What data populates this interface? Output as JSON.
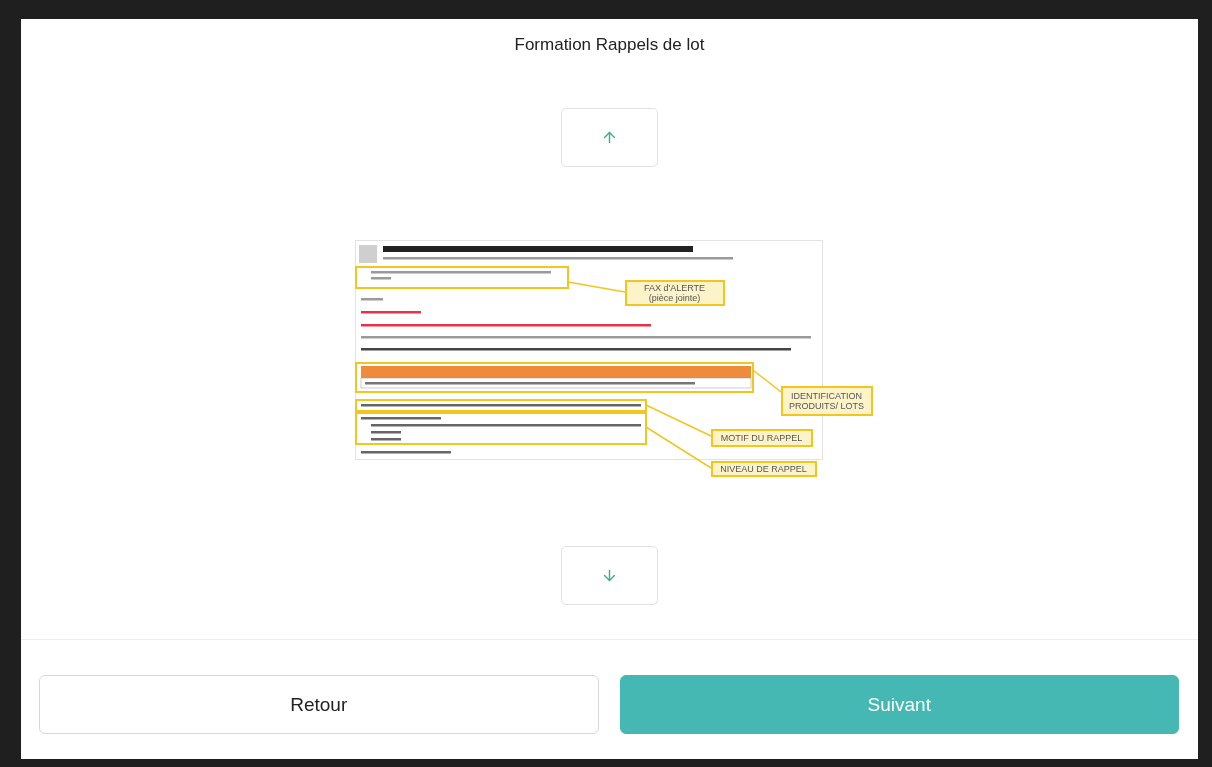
{
  "title": "Formation Rappels de lot",
  "nav": {
    "up": {
      "disabled": false
    },
    "down": {
      "disabled": false
    }
  },
  "slide": {
    "kind": "picture",
    "callouts": [
      {
        "lines": [
          "FAX d'ALERTE",
          "(pièce jointe)"
        ]
      },
      {
        "lines": [
          "IDENTIFICATION",
          "PRODUITS/ LOTS"
        ]
      },
      {
        "lines": [
          "MOTIF DU RAPPEL"
        ]
      },
      {
        "lines": [
          "NIVEAU DE RAPPEL"
        ]
      }
    ]
  },
  "buttons": [
    {
      "label": "Retour",
      "kind": "secondary"
    },
    {
      "label": "Suivant",
      "kind": "primary"
    }
  ]
}
